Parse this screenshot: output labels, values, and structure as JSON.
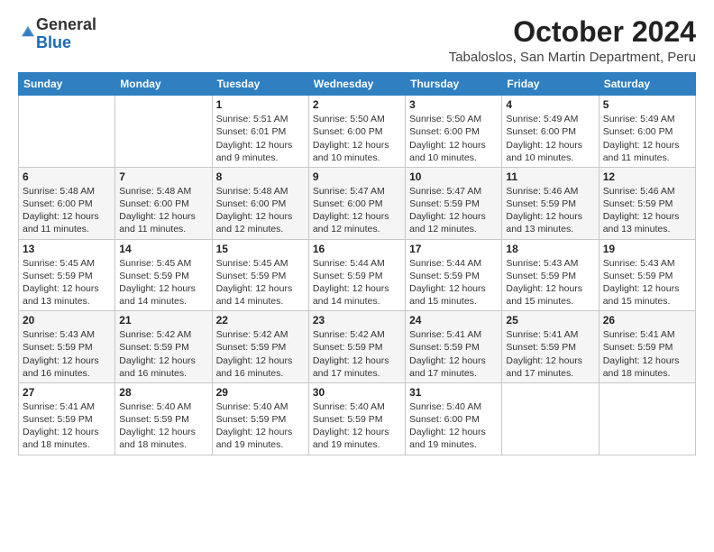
{
  "logo": {
    "general": "General",
    "blue": "Blue"
  },
  "header": {
    "month_year": "October 2024",
    "location": "Tabaloslos, San Martin Department, Peru"
  },
  "weekdays": [
    "Sunday",
    "Monday",
    "Tuesday",
    "Wednesday",
    "Thursday",
    "Friday",
    "Saturday"
  ],
  "weeks": [
    [
      {
        "day": "",
        "info": ""
      },
      {
        "day": "",
        "info": ""
      },
      {
        "day": "1",
        "info": "Sunrise: 5:51 AM\nSunset: 6:01 PM\nDaylight: 12 hours\nand 9 minutes."
      },
      {
        "day": "2",
        "info": "Sunrise: 5:50 AM\nSunset: 6:00 PM\nDaylight: 12 hours\nand 10 minutes."
      },
      {
        "day": "3",
        "info": "Sunrise: 5:50 AM\nSunset: 6:00 PM\nDaylight: 12 hours\nand 10 minutes."
      },
      {
        "day": "4",
        "info": "Sunrise: 5:49 AM\nSunset: 6:00 PM\nDaylight: 12 hours\nand 10 minutes."
      },
      {
        "day": "5",
        "info": "Sunrise: 5:49 AM\nSunset: 6:00 PM\nDaylight: 12 hours\nand 11 minutes."
      }
    ],
    [
      {
        "day": "6",
        "info": "Sunrise: 5:48 AM\nSunset: 6:00 PM\nDaylight: 12 hours\nand 11 minutes."
      },
      {
        "day": "7",
        "info": "Sunrise: 5:48 AM\nSunset: 6:00 PM\nDaylight: 12 hours\nand 11 minutes."
      },
      {
        "day": "8",
        "info": "Sunrise: 5:48 AM\nSunset: 6:00 PM\nDaylight: 12 hours\nand 12 minutes."
      },
      {
        "day": "9",
        "info": "Sunrise: 5:47 AM\nSunset: 6:00 PM\nDaylight: 12 hours\nand 12 minutes."
      },
      {
        "day": "10",
        "info": "Sunrise: 5:47 AM\nSunset: 5:59 PM\nDaylight: 12 hours\nand 12 minutes."
      },
      {
        "day": "11",
        "info": "Sunrise: 5:46 AM\nSunset: 5:59 PM\nDaylight: 12 hours\nand 13 minutes."
      },
      {
        "day": "12",
        "info": "Sunrise: 5:46 AM\nSunset: 5:59 PM\nDaylight: 12 hours\nand 13 minutes."
      }
    ],
    [
      {
        "day": "13",
        "info": "Sunrise: 5:45 AM\nSunset: 5:59 PM\nDaylight: 12 hours\nand 13 minutes."
      },
      {
        "day": "14",
        "info": "Sunrise: 5:45 AM\nSunset: 5:59 PM\nDaylight: 12 hours\nand 14 minutes."
      },
      {
        "day": "15",
        "info": "Sunrise: 5:45 AM\nSunset: 5:59 PM\nDaylight: 12 hours\nand 14 minutes."
      },
      {
        "day": "16",
        "info": "Sunrise: 5:44 AM\nSunset: 5:59 PM\nDaylight: 12 hours\nand 14 minutes."
      },
      {
        "day": "17",
        "info": "Sunrise: 5:44 AM\nSunset: 5:59 PM\nDaylight: 12 hours\nand 15 minutes."
      },
      {
        "day": "18",
        "info": "Sunrise: 5:43 AM\nSunset: 5:59 PM\nDaylight: 12 hours\nand 15 minutes."
      },
      {
        "day": "19",
        "info": "Sunrise: 5:43 AM\nSunset: 5:59 PM\nDaylight: 12 hours\nand 15 minutes."
      }
    ],
    [
      {
        "day": "20",
        "info": "Sunrise: 5:43 AM\nSunset: 5:59 PM\nDaylight: 12 hours\nand 16 minutes."
      },
      {
        "day": "21",
        "info": "Sunrise: 5:42 AM\nSunset: 5:59 PM\nDaylight: 12 hours\nand 16 minutes."
      },
      {
        "day": "22",
        "info": "Sunrise: 5:42 AM\nSunset: 5:59 PM\nDaylight: 12 hours\nand 16 minutes."
      },
      {
        "day": "23",
        "info": "Sunrise: 5:42 AM\nSunset: 5:59 PM\nDaylight: 12 hours\nand 17 minutes."
      },
      {
        "day": "24",
        "info": "Sunrise: 5:41 AM\nSunset: 5:59 PM\nDaylight: 12 hours\nand 17 minutes."
      },
      {
        "day": "25",
        "info": "Sunrise: 5:41 AM\nSunset: 5:59 PM\nDaylight: 12 hours\nand 17 minutes."
      },
      {
        "day": "26",
        "info": "Sunrise: 5:41 AM\nSunset: 5:59 PM\nDaylight: 12 hours\nand 18 minutes."
      }
    ],
    [
      {
        "day": "27",
        "info": "Sunrise: 5:41 AM\nSunset: 5:59 PM\nDaylight: 12 hours\nand 18 minutes."
      },
      {
        "day": "28",
        "info": "Sunrise: 5:40 AM\nSunset: 5:59 PM\nDaylight: 12 hours\nand 18 minutes."
      },
      {
        "day": "29",
        "info": "Sunrise: 5:40 AM\nSunset: 5:59 PM\nDaylight: 12 hours\nand 19 minutes."
      },
      {
        "day": "30",
        "info": "Sunrise: 5:40 AM\nSunset: 5:59 PM\nDaylight: 12 hours\nand 19 minutes."
      },
      {
        "day": "31",
        "info": "Sunrise: 5:40 AM\nSunset: 6:00 PM\nDaylight: 12 hours\nand 19 minutes."
      },
      {
        "day": "",
        "info": ""
      },
      {
        "day": "",
        "info": ""
      }
    ]
  ]
}
